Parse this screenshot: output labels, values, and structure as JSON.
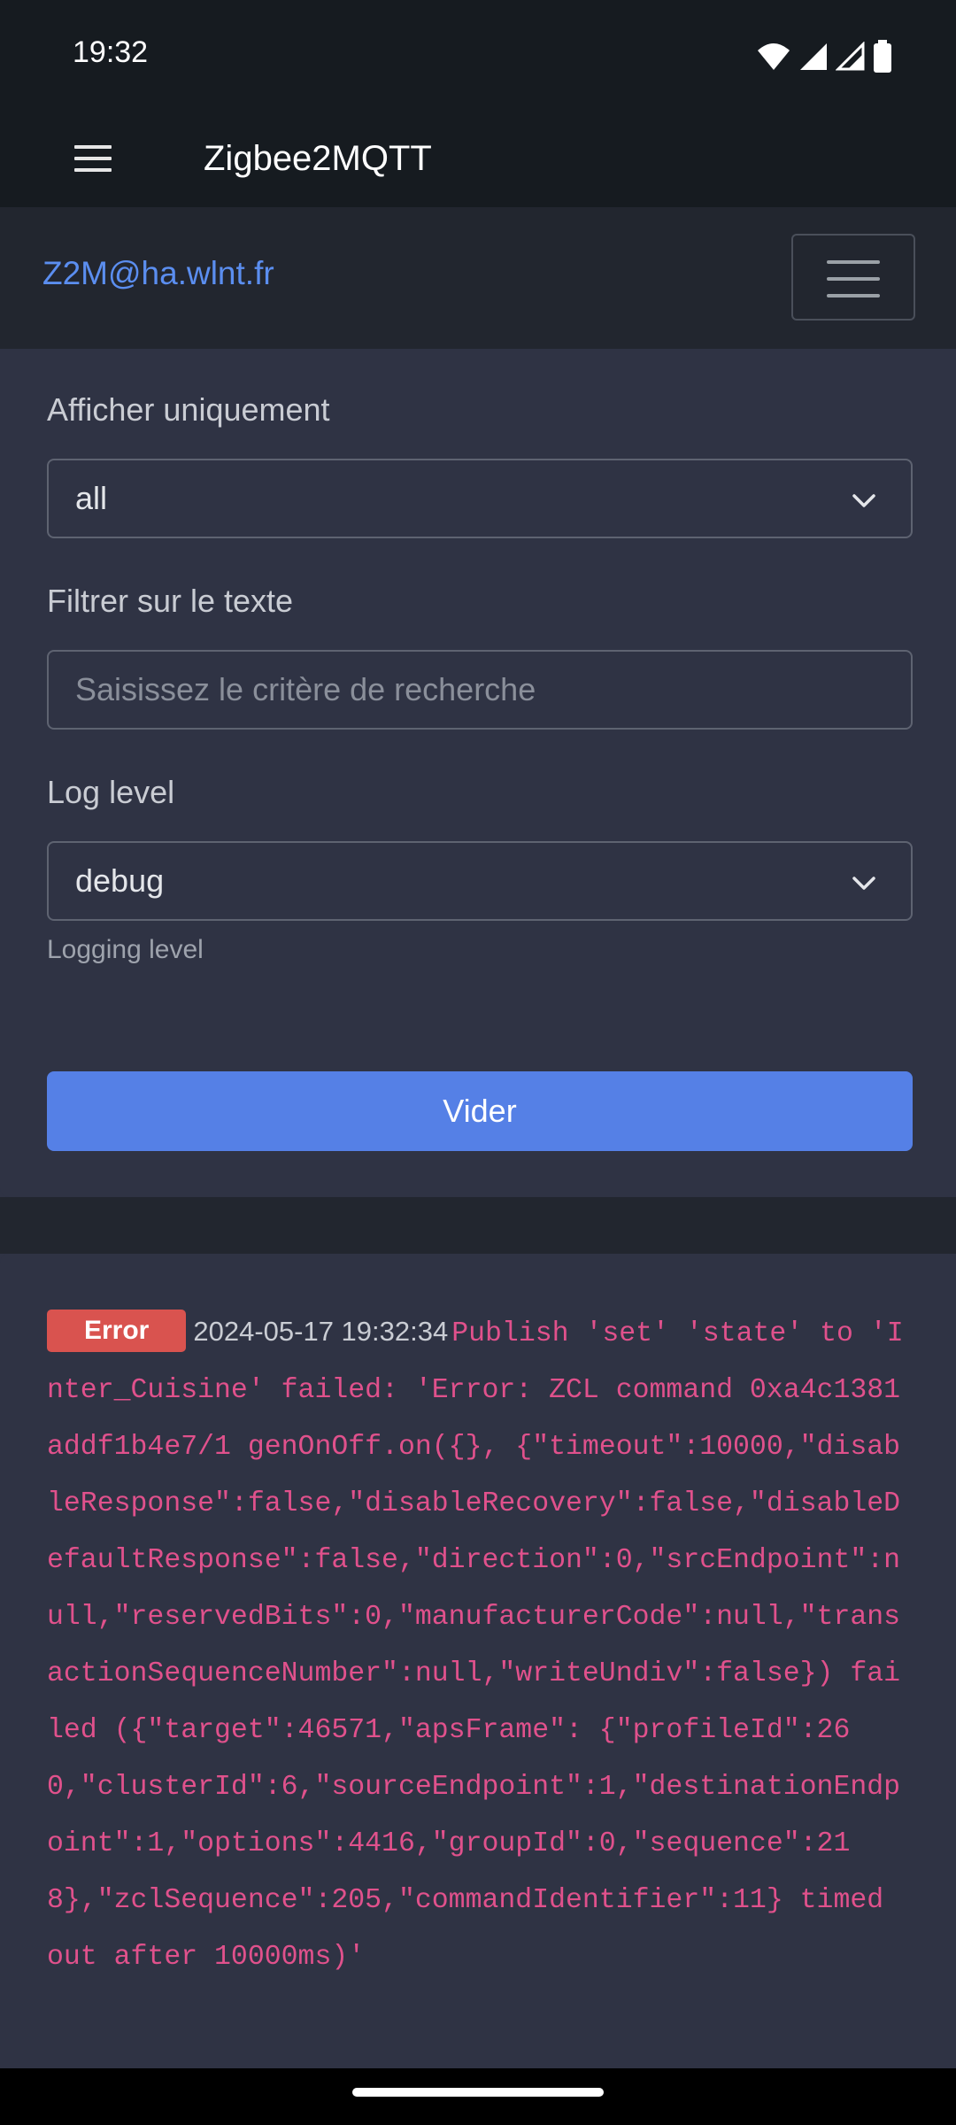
{
  "status_bar": {
    "time": "19:32",
    "icons": [
      "wifi-icon",
      "signal-icon",
      "signal-outline-icon",
      "battery-icon"
    ]
  },
  "app_bar": {
    "title": "Zigbee2MQTT"
  },
  "navbar": {
    "brand": "Z2M@ha.wlnt.fr"
  },
  "filters": {
    "show_only_label": "Afficher uniquement",
    "show_only_value": "all",
    "text_filter_label": "Filtrer sur le texte",
    "text_filter_placeholder": "Saisissez le critère de recherche",
    "log_level_label": "Log level",
    "log_level_value": "debug",
    "log_level_help": "Logging level",
    "clear_label": "Vider"
  },
  "logs": [
    {
      "level": "Error",
      "timestamp": "2024-05-17 19:32:34",
      "message": "Publish 'set' 'state' to 'Inter_Cuisine' failed: 'Error: ZCL command 0xa4c1381addf1b4e7/1 genOnOff.on({}, {\"timeout\":10000,\"disableResponse\":false,\"disableRecovery\":false,\"disableDefaultResponse\":false,\"direction\":0,\"srcEndpoint\":null,\"reservedBits\":0,\"manufacturerCode\":null,\"transactionSequenceNumber\":null,\"writeUndiv\":false}) failed ({\"target\":46571,\"apsFrame\": {\"profileId\":260,\"clusterId\":6,\"sourceEndpoint\":1,\"destinationEndpoint\":1,\"options\":4416,\"groupId\":0,\"sequence\":218},\"zclSequence\":205,\"commandIdentifier\":11} timed out after 10000ms)'"
    }
  ],
  "colors": {
    "accent": "#5580e6",
    "link": "#5b8ef0",
    "error_badge": "#d9534f",
    "log_text": "#e0518c"
  }
}
